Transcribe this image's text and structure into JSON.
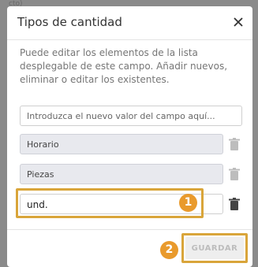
{
  "background": {
    "peek_text": "cto)"
  },
  "dialog": {
    "title": "Tipos de cantidad",
    "description": "Puede editar los elementos de la lista desplegable de este campo. Añadir nuevos, eliminar o editar los existentes.",
    "new_value_placeholder": "Introduzca el nuevo valor del campo aquí...",
    "items": [
      {
        "value": "Horario",
        "editable": false
      },
      {
        "value": "Piezas",
        "editable": false
      },
      {
        "value": "und.",
        "editable": true
      }
    ],
    "save_label": "GUARDAR"
  },
  "annotations": {
    "step1": "1",
    "step2": "2"
  },
  "colors": {
    "highlight": "#d9a53a",
    "badge": "#e99a2c",
    "disabled_field": "#e8e9ee"
  }
}
